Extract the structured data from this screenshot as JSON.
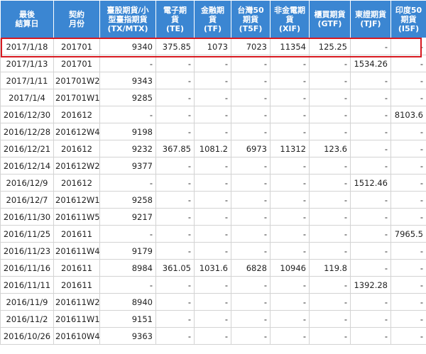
{
  "table": {
    "columns": [
      {
        "lines": [
          "最後",
          "結算日"
        ]
      },
      {
        "lines": [
          "契約",
          "月份"
        ]
      },
      {
        "lines": [
          "臺股期貨/小",
          "型臺指期貨",
          "(TX/MTX)"
        ]
      },
      {
        "lines": [
          "電子期",
          "貨",
          "(TE)"
        ]
      },
      {
        "lines": [
          "金融期",
          "貨",
          "(TF)"
        ]
      },
      {
        "lines": [
          "台灣50",
          "期貨",
          "(T5F)"
        ]
      },
      {
        "lines": [
          "非金電期",
          "貨",
          "(XIF)"
        ]
      },
      {
        "lines": [
          "櫃買期貨",
          "(GTF)"
        ]
      },
      {
        "lines": [
          "東證期貨",
          "(TJF)"
        ]
      },
      {
        "lines": [
          "印度50",
          "期貨",
          "(I5F)"
        ]
      }
    ],
    "rows": [
      [
        "2017/1/18",
        "201701",
        "9340",
        "375.85",
        "1073",
        "7023",
        "11354",
        "125.25",
        "-",
        "-"
      ],
      [
        "2017/1/13",
        "201701",
        "-",
        "-",
        "-",
        "-",
        "-",
        "-",
        "1534.26",
        "-"
      ],
      [
        "2017/1/11",
        "201701W2",
        "9343",
        "-",
        "-",
        "-",
        "-",
        "-",
        "-",
        "-"
      ],
      [
        "2017/1/4",
        "201701W1",
        "9285",
        "-",
        "-",
        "-",
        "-",
        "-",
        "-",
        "-"
      ],
      [
        "2016/12/30",
        "201612",
        "-",
        "-",
        "-",
        "-",
        "-",
        "-",
        "-",
        "8103.6"
      ],
      [
        "2016/12/28",
        "201612W4",
        "9198",
        "-",
        "-",
        "-",
        "-",
        "-",
        "-",
        "-"
      ],
      [
        "2016/12/21",
        "201612",
        "9232",
        "367.85",
        "1081.2",
        "6973",
        "11312",
        "123.6",
        "-",
        "-"
      ],
      [
        "2016/12/14",
        "201612W2",
        "9377",
        "-",
        "-",
        "-",
        "-",
        "-",
        "-",
        "-"
      ],
      [
        "2016/12/9",
        "201612",
        "-",
        "-",
        "-",
        "-",
        "-",
        "-",
        "1512.46",
        "-"
      ],
      [
        "2016/12/7",
        "201612W1",
        "9258",
        "-",
        "-",
        "-",
        "-",
        "-",
        "-",
        "-"
      ],
      [
        "2016/11/30",
        "201611W5",
        "9217",
        "-",
        "-",
        "-",
        "-",
        "-",
        "-",
        "-"
      ],
      [
        "2016/11/25",
        "201611",
        "-",
        "-",
        "-",
        "-",
        "-",
        "-",
        "-",
        "7965.5"
      ],
      [
        "2016/11/23",
        "201611W4",
        "9179",
        "-",
        "-",
        "-",
        "-",
        "-",
        "-",
        "-"
      ],
      [
        "2016/11/16",
        "201611",
        "8984",
        "361.05",
        "1031.6",
        "6828",
        "10946",
        "119.8",
        "-",
        "-"
      ],
      [
        "2016/11/11",
        "201611",
        "-",
        "-",
        "-",
        "-",
        "-",
        "-",
        "1392.28",
        "-"
      ],
      [
        "2016/11/9",
        "201611W2",
        "8940",
        "-",
        "-",
        "-",
        "-",
        "-",
        "-",
        "-"
      ],
      [
        "2016/11/2",
        "201611W1",
        "9151",
        "-",
        "-",
        "-",
        "-",
        "-",
        "-",
        "-"
      ],
      [
        "2016/10/26",
        "201610W4",
        "9363",
        "-",
        "-",
        "-",
        "-",
        "-",
        "-",
        "-"
      ]
    ],
    "highlight_row": 0,
    "colors": {
      "header_bg": "#3b86d2",
      "header_text": "#ffffff",
      "highlight_border": "#d71920",
      "grid": "#d3d3d3"
    }
  }
}
